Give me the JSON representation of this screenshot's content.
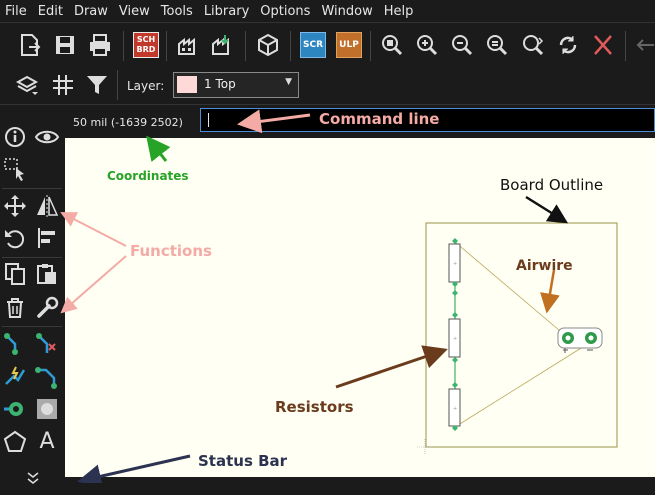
{
  "menu": [
    "File",
    "Edit",
    "Draw",
    "View",
    "Tools",
    "Library",
    "Options",
    "Window",
    "Help"
  ],
  "toolbar": {
    "sch_brd": [
      "SCH",
      "BRD"
    ],
    "scr": "SCR",
    "ulp": "ULP"
  },
  "layer": {
    "label": "Layer:",
    "value": "1 Top",
    "color": "#ffd8d8"
  },
  "coordinates": "50 mil (-1639 2502)",
  "command_line": {
    "value": ""
  },
  "annotations": {
    "command_line": "Command line",
    "coordinates": "Coordinates",
    "functions": "Functions",
    "board_outline": "Board Outline",
    "airwire": "Airwire",
    "resistors": "Resistors",
    "status_bar": "Status Bar"
  },
  "sidebar_text_tool": "A",
  "colors": {
    "canvas": "#fffff3",
    "annotation_pink": "#f4aaa5",
    "annotation_green": "#27a327",
    "annotation_brown": "#6b3b1e",
    "airwire": "#b8741c",
    "command_border": "#4a8ed8",
    "board_outline": "#9a9346",
    "pad_green": "#2f9a4a"
  }
}
